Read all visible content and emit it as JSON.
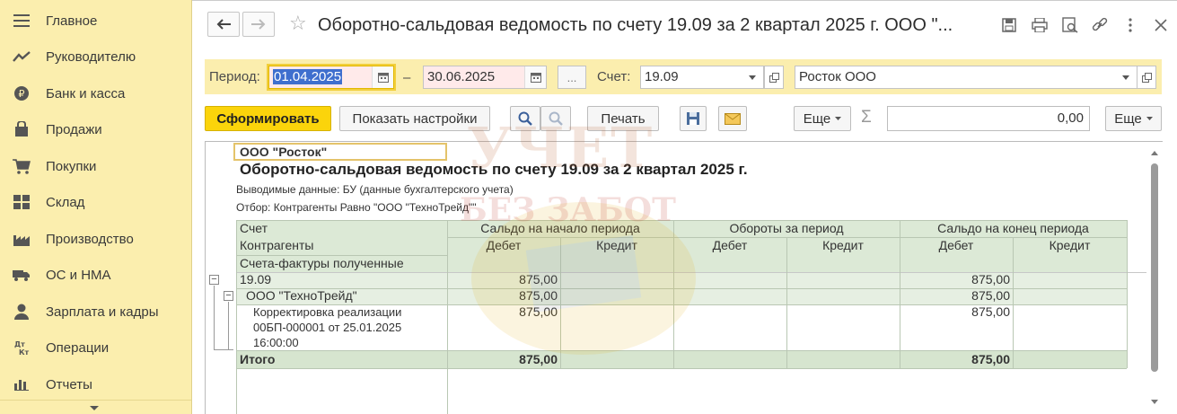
{
  "sidebar": {
    "items": [
      {
        "label": "Главное",
        "icon": "menu-lines-icon"
      },
      {
        "label": "Руководителю",
        "icon": "trend-chart-icon"
      },
      {
        "label": "Банк и касса",
        "icon": "coin-icon"
      },
      {
        "label": "Продажи",
        "icon": "shopping-bag-icon"
      },
      {
        "label": "Покупки",
        "icon": "shopping-cart-icon"
      },
      {
        "label": "Склад",
        "icon": "warehouse-icon"
      },
      {
        "label": "Производство",
        "icon": "factory-icon"
      },
      {
        "label": "ОС и НМА",
        "icon": "truck-icon"
      },
      {
        "label": "Зарплата и кадры",
        "icon": "person-icon"
      },
      {
        "label": "Операции",
        "icon": "dt-kt-icon"
      },
      {
        "label": "Отчеты",
        "icon": "bar-chart-icon"
      }
    ]
  },
  "window": {
    "title": "Оборотно-сальдовая ведомость по счету 19.09 за 2 квартал 2025 г. ООО \"..."
  },
  "filter": {
    "period_label": "Период:",
    "date_from": "01.04.2025",
    "dash": "–",
    "date_to": "30.06.2025",
    "more_button": "...",
    "account_label": "Счет:",
    "account_value": "19.09",
    "organization_value": "Росток ООО"
  },
  "toolbar": {
    "generate_label": "Сформировать",
    "settings_label": "Показать настройки",
    "print_label": "Печать",
    "more_label": "Еще",
    "sigma": "Σ",
    "sum_value": "0,00",
    "more_label_right": "Еще"
  },
  "report": {
    "org_name": "ООО \"Росток\"",
    "title": "Оборотно-сальдовая ведомость по счету 19.09 за 2 квартал 2025 г.",
    "output_data": "Выводимые данные: БУ (данные бухгалтерского учета)",
    "filter_text": "Отбор: Контрагенты Равно \"ООО \"ТехноТрейд\"\"",
    "headers": {
      "account": "Счет",
      "counterparties": "Контрагенты",
      "invoices": "Счета-фактуры полученные",
      "opening_balance": "Сальдо на начало периода",
      "turnover": "Обороты за период",
      "closing_balance": "Сальдо на конец периода",
      "debit": "Дебет",
      "credit": "Кредит"
    },
    "rows": [
      {
        "name": "19.09",
        "open_debit": "875,00",
        "open_credit": "",
        "turn_debit": "",
        "turn_credit": "",
        "close_debit": "875,00",
        "close_credit": ""
      },
      {
        "name": "ООО \"ТехноТрейд\"",
        "open_debit": "875,00",
        "open_credit": "",
        "turn_debit": "",
        "turn_credit": "",
        "close_debit": "875,00",
        "close_credit": ""
      },
      {
        "name_lines": [
          "Корректировка реализации",
          "00БП-000001 от 25.01.2025",
          "16:00:00"
        ],
        "open_debit": "875,00",
        "open_credit": "",
        "turn_debit": "",
        "turn_credit": "",
        "close_debit": "875,00",
        "close_credit": ""
      }
    ],
    "total": {
      "label": "Итого",
      "open_debit": "875,00",
      "close_debit": "875,00"
    }
  },
  "watermark": {
    "line1": "УЧЕТ",
    "line2": "БЕЗ ЗАБОТ"
  }
}
